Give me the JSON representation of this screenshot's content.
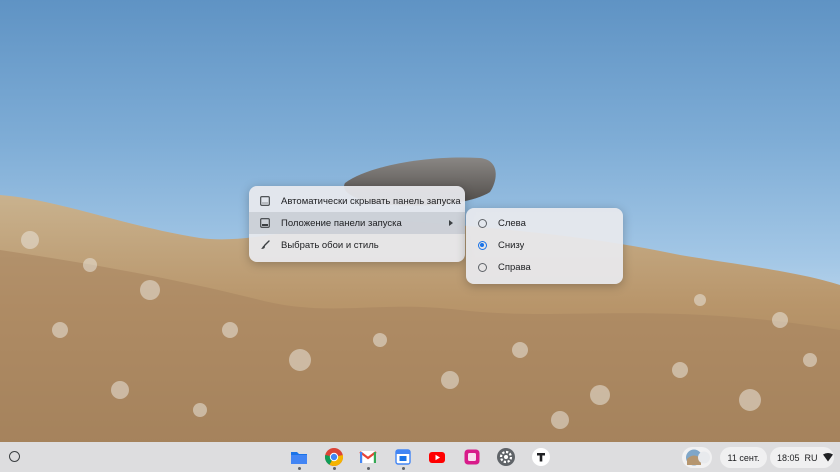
{
  "context_menu": {
    "items": [
      {
        "label": "Автоматически скрывать панель запуска",
        "icon": "autohide-shelf-icon"
      },
      {
        "label": "Положение панели запуска",
        "icon": "shelf-position-icon",
        "has_submenu": true
      },
      {
        "label": "Выбрать обои и стиль",
        "icon": "paintbrush-icon"
      }
    ]
  },
  "position_submenu": {
    "options": [
      {
        "label": "Слева",
        "selected": false
      },
      {
        "label": "Снизу",
        "selected": true
      },
      {
        "label": "Справа",
        "selected": false
      }
    ]
  },
  "shelf": {
    "apps": [
      {
        "name": "files",
        "icon": "files-folder-icon",
        "color": "#1a73e8"
      },
      {
        "name": "chrome",
        "icon": "chrome-icon"
      },
      {
        "name": "gmail",
        "icon": "gmail-icon"
      },
      {
        "name": "calendar",
        "icon": "calendar-icon",
        "color": "#1a73e8"
      },
      {
        "name": "youtube",
        "icon": "youtube-icon",
        "color": "#ff0000"
      },
      {
        "name": "app-purple",
        "icon": "purple-app-icon",
        "color": "#d81b8a"
      },
      {
        "name": "settings",
        "icon": "settings-gear-icon",
        "color": "#5f6368"
      },
      {
        "name": "app-t",
        "icon": "t-app-icon",
        "color": "#202124"
      }
    ],
    "date": "11 сент.",
    "time": "18:05",
    "keyboard_layout": "RU"
  }
}
